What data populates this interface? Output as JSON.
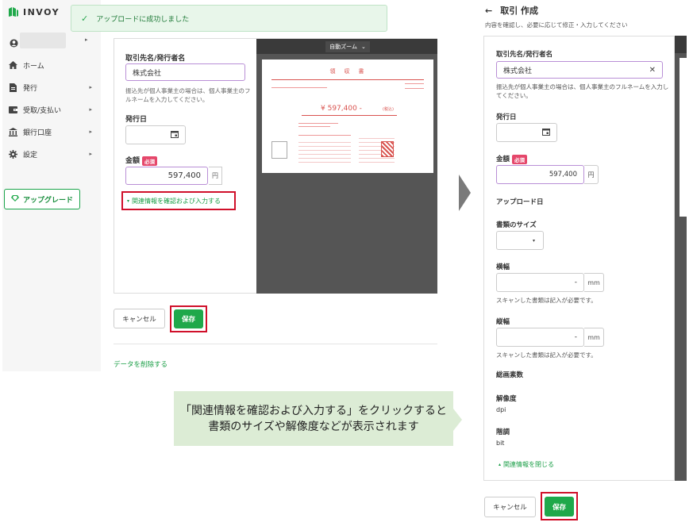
{
  "app": {
    "logo_text": "INVOY"
  },
  "toast": {
    "message": "アップロードに成功しました"
  },
  "sidebar": {
    "items": [
      {
        "label": "ホーム",
        "icon": "home-icon",
        "has_submenu": false
      },
      {
        "label": "発行",
        "icon": "document-icon",
        "has_submenu": true
      },
      {
        "label": "受取/支払い",
        "icon": "wallet-icon",
        "has_submenu": true
      },
      {
        "label": "銀行口座",
        "icon": "bank-icon",
        "has_submenu": true
      },
      {
        "label": "設定",
        "icon": "gear-icon",
        "has_submenu": true
      }
    ],
    "upgrade_label": "アップグレード"
  },
  "left_form": {
    "partner_label": "取引先名/発行者名",
    "partner_value": "株式会社",
    "partner_help_line1": "振込先が個人事業主の場合は、個人事業主のフ",
    "partner_help_line2": "ルネームを入力してください。",
    "issue_date_label": "発行日",
    "amount_label": "金額",
    "required_badge": "必須",
    "amount_value": "597,400",
    "currency_unit": "円",
    "related_info_link": "関連情報を確認および入力する",
    "cancel_label": "キャンセル",
    "save_label": "保存",
    "delete_label": "データを削除する"
  },
  "preview": {
    "zoom_label": "自動ズーム",
    "receipt_title": "領　収　書",
    "receipt_amount": "¥ 597,400 -",
    "receipt_tax_note": "(税込)"
  },
  "caption": {
    "line1": "「関連情報を確認および入力する」をクリックすると",
    "line2": "書類のサイズや解像度などが表示されます"
  },
  "right_form": {
    "title": "取引 作成",
    "subtitle": "内容を確認し、必要に応じて修正・入力してください",
    "partner_label": "取引先名/発行者名",
    "partner_value": "株式会社",
    "partner_help_line1": "振込先が個人事業主の場合は、個人事業主のフルネームを入力し",
    "partner_help_line2": "てください。",
    "issue_date_label": "発行日",
    "amount_label": "金額",
    "required_badge": "必須",
    "amount_value": "597,400",
    "currency_unit": "円",
    "upload_date_label": "アップロード日",
    "doc_size_label": "書類のサイズ",
    "width_label": "横幅",
    "width_value": "-",
    "width_unit": "mm",
    "width_help": "スキャンした書類は記入が必要です。",
    "height_label": "縦幅",
    "height_value": "-",
    "height_unit": "mm",
    "height_help": "スキャンした書類は記入が必要です。",
    "total_pixels_label": "総画素数",
    "resolution_label": "解像度",
    "resolution_unit": "dpi",
    "gradation_label": "階調",
    "gradation_unit": "bit",
    "close_related_link": "関連情報を閉じる",
    "cancel_label": "キャンセル",
    "save_label": "保存"
  },
  "colors": {
    "accent_green": "#1fa84a",
    "highlight_red": "#d0102a",
    "required_pink": "#e5476b"
  }
}
